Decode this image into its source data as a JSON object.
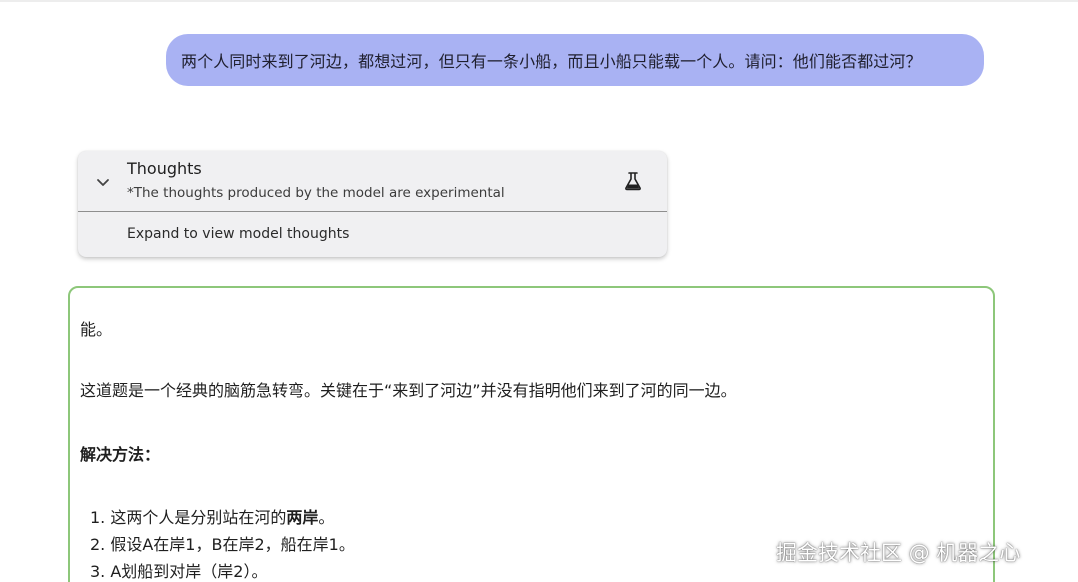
{
  "user_message": "两个人同时来到了河边，都想过河，但只有一条小船，而且小船只能载一个人。请问：他们能否都过河？",
  "thoughts": {
    "title": "Thoughts",
    "subtitle": "*The thoughts produced by the model are experimental",
    "expand_label": "Expand to view model thoughts",
    "chevron_icon": "chevron-down-icon",
    "flask_icon": "flask-icon"
  },
  "answer": {
    "p1": "能。",
    "p2": "这道题是一个经典的脑筋急转弯。关键在于“来到了河边”并没有指明他们来到了河的同一边。",
    "p3": "解决方法：",
    "steps": [
      {
        "num": "1.",
        "pre": "这两个人是分别站在河的",
        "bold": "两岸",
        "post": "。"
      },
      {
        "num": "2.",
        "pre": "假设A在岸1，B在岸2，船在岸1。",
        "bold": "",
        "post": ""
      },
      {
        "num": "3.",
        "pre": "A划船到对岸（岸2）。",
        "bold": "",
        "post": ""
      }
    ]
  },
  "watermark": "掘金技术社区 @ 机器之心",
  "colors": {
    "user_bubble": "#a9b2f3",
    "answer_border": "#8dc77a",
    "thoughts_bg": "#f0f0f2"
  }
}
